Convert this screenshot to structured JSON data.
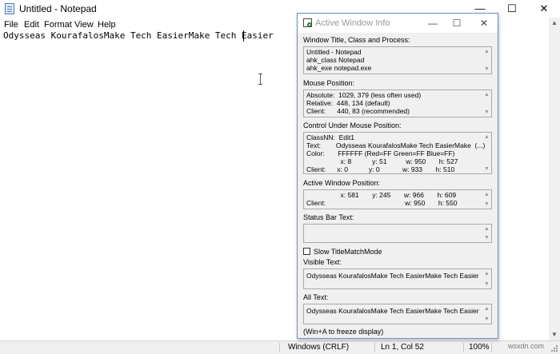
{
  "notepad": {
    "title": "Untitled - Notepad",
    "window_buttons": {
      "minimize": "—",
      "maximize": "☐",
      "close": "✕"
    },
    "menu": [
      "File",
      "Edit",
      "Format",
      "View",
      "Help"
    ],
    "content": "Odysseas KourafalosMake Tech EasierMake Tech Easier",
    "status": {
      "line_endings": "Windows (CRLF)",
      "position": "Ln 1, Col 52",
      "zoom": "100%"
    }
  },
  "awi": {
    "title": "Active Window Info",
    "window_buttons": {
      "minimize": "—",
      "maximize": "☐",
      "close": "✕"
    },
    "sections": {
      "window_title": {
        "label": "Window Title, Class and Process:",
        "lines": [
          "Untitled - Notepad",
          "ahk_class Notepad",
          "ahk_exe notepad.exe"
        ]
      },
      "mouse_position": {
        "label": "Mouse Position:",
        "lines": [
          "Absolute:  1029, 379 (less often used)",
          "Relative:  448, 134 (default)",
          "Client:      440, 83 (recommended)"
        ]
      },
      "control_under_mouse": {
        "label": "Control Under Mouse Position:",
        "lines": [
          "ClassNN:  Edit1",
          "Text:        Odysseas KourafalosMake Tech EasierMake  (...)",
          "Color:       FFFFFF (Red=FF Green=FF Blue=FF)",
          "                  x: 8           y: 51          w: 950       h: 527",
          "Client:      x: 0           y: 0            w: 933       h: 510"
        ]
      },
      "active_window_position": {
        "label": "Active Window Position:",
        "lines": [
          "                  x: 581       y: 245       w: 966       h: 609",
          "Client:                                          w: 950       h: 550"
        ]
      },
      "status_bar_text": {
        "label": "Status Bar Text:"
      },
      "slow_match": {
        "label": "Slow TitleMatchMode",
        "checked": false
      },
      "visible_text": {
        "label": "Visible Text:",
        "value": "Odysseas KourafalosMake Tech EasierMake Tech Easier"
      },
      "all_text": {
        "label": "All Text:",
        "value": "Odysseas KourafalosMake Tech EasierMake Tech Easier"
      },
      "footer": "(Win+A to freeze display)"
    }
  },
  "watermark": "wsxdn.com"
}
